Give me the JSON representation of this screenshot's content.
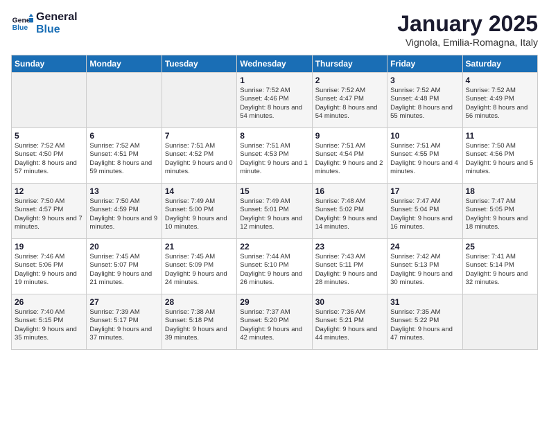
{
  "logo": {
    "line1": "General",
    "line2": "Blue"
  },
  "title": "January 2025",
  "subtitle": "Vignola, Emilia-Romagna, Italy",
  "days_of_week": [
    "Sunday",
    "Monday",
    "Tuesday",
    "Wednesday",
    "Thursday",
    "Friday",
    "Saturday"
  ],
  "weeks": [
    [
      {
        "day": "",
        "info": ""
      },
      {
        "day": "",
        "info": ""
      },
      {
        "day": "",
        "info": ""
      },
      {
        "day": "1",
        "info": "Sunrise: 7:52 AM\nSunset: 4:46 PM\nDaylight: 8 hours\nand 54 minutes."
      },
      {
        "day": "2",
        "info": "Sunrise: 7:52 AM\nSunset: 4:47 PM\nDaylight: 8 hours\nand 54 minutes."
      },
      {
        "day": "3",
        "info": "Sunrise: 7:52 AM\nSunset: 4:48 PM\nDaylight: 8 hours\nand 55 minutes."
      },
      {
        "day": "4",
        "info": "Sunrise: 7:52 AM\nSunset: 4:49 PM\nDaylight: 8 hours\nand 56 minutes."
      }
    ],
    [
      {
        "day": "5",
        "info": "Sunrise: 7:52 AM\nSunset: 4:50 PM\nDaylight: 8 hours\nand 57 minutes."
      },
      {
        "day": "6",
        "info": "Sunrise: 7:52 AM\nSunset: 4:51 PM\nDaylight: 8 hours\nand 59 minutes."
      },
      {
        "day": "7",
        "info": "Sunrise: 7:51 AM\nSunset: 4:52 PM\nDaylight: 9 hours\nand 0 minutes."
      },
      {
        "day": "8",
        "info": "Sunrise: 7:51 AM\nSunset: 4:53 PM\nDaylight: 9 hours\nand 1 minute."
      },
      {
        "day": "9",
        "info": "Sunrise: 7:51 AM\nSunset: 4:54 PM\nDaylight: 9 hours\nand 2 minutes."
      },
      {
        "day": "10",
        "info": "Sunrise: 7:51 AM\nSunset: 4:55 PM\nDaylight: 9 hours\nand 4 minutes."
      },
      {
        "day": "11",
        "info": "Sunrise: 7:50 AM\nSunset: 4:56 PM\nDaylight: 9 hours\nand 5 minutes."
      }
    ],
    [
      {
        "day": "12",
        "info": "Sunrise: 7:50 AM\nSunset: 4:57 PM\nDaylight: 9 hours\nand 7 minutes."
      },
      {
        "day": "13",
        "info": "Sunrise: 7:50 AM\nSunset: 4:59 PM\nDaylight: 9 hours\nand 9 minutes."
      },
      {
        "day": "14",
        "info": "Sunrise: 7:49 AM\nSunset: 5:00 PM\nDaylight: 9 hours\nand 10 minutes."
      },
      {
        "day": "15",
        "info": "Sunrise: 7:49 AM\nSunset: 5:01 PM\nDaylight: 9 hours\nand 12 minutes."
      },
      {
        "day": "16",
        "info": "Sunrise: 7:48 AM\nSunset: 5:02 PM\nDaylight: 9 hours\nand 14 minutes."
      },
      {
        "day": "17",
        "info": "Sunrise: 7:47 AM\nSunset: 5:04 PM\nDaylight: 9 hours\nand 16 minutes."
      },
      {
        "day": "18",
        "info": "Sunrise: 7:47 AM\nSunset: 5:05 PM\nDaylight: 9 hours\nand 18 minutes."
      }
    ],
    [
      {
        "day": "19",
        "info": "Sunrise: 7:46 AM\nSunset: 5:06 PM\nDaylight: 9 hours\nand 19 minutes."
      },
      {
        "day": "20",
        "info": "Sunrise: 7:45 AM\nSunset: 5:07 PM\nDaylight: 9 hours\nand 21 minutes."
      },
      {
        "day": "21",
        "info": "Sunrise: 7:45 AM\nSunset: 5:09 PM\nDaylight: 9 hours\nand 24 minutes."
      },
      {
        "day": "22",
        "info": "Sunrise: 7:44 AM\nSunset: 5:10 PM\nDaylight: 9 hours\nand 26 minutes."
      },
      {
        "day": "23",
        "info": "Sunrise: 7:43 AM\nSunset: 5:11 PM\nDaylight: 9 hours\nand 28 minutes."
      },
      {
        "day": "24",
        "info": "Sunrise: 7:42 AM\nSunset: 5:13 PM\nDaylight: 9 hours\nand 30 minutes."
      },
      {
        "day": "25",
        "info": "Sunrise: 7:41 AM\nSunset: 5:14 PM\nDaylight: 9 hours\nand 32 minutes."
      }
    ],
    [
      {
        "day": "26",
        "info": "Sunrise: 7:40 AM\nSunset: 5:15 PM\nDaylight: 9 hours\nand 35 minutes."
      },
      {
        "day": "27",
        "info": "Sunrise: 7:39 AM\nSunset: 5:17 PM\nDaylight: 9 hours\nand 37 minutes."
      },
      {
        "day": "28",
        "info": "Sunrise: 7:38 AM\nSunset: 5:18 PM\nDaylight: 9 hours\nand 39 minutes."
      },
      {
        "day": "29",
        "info": "Sunrise: 7:37 AM\nSunset: 5:20 PM\nDaylight: 9 hours\nand 42 minutes."
      },
      {
        "day": "30",
        "info": "Sunrise: 7:36 AM\nSunset: 5:21 PM\nDaylight: 9 hours\nand 44 minutes."
      },
      {
        "day": "31",
        "info": "Sunrise: 7:35 AM\nSunset: 5:22 PM\nDaylight: 9 hours\nand 47 minutes."
      },
      {
        "day": "",
        "info": ""
      }
    ]
  ]
}
